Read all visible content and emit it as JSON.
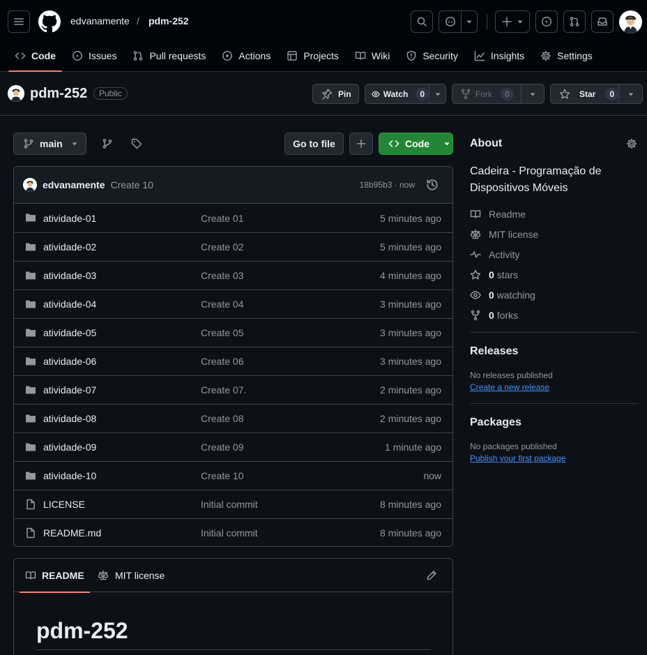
{
  "header": {
    "owner": "edvanamente",
    "separator": "/",
    "repo": "pdm-252"
  },
  "nav": [
    {
      "label": "Code",
      "icon": "code-icon"
    },
    {
      "label": "Issues",
      "icon": "issue-icon"
    },
    {
      "label": "Pull requests",
      "icon": "pull-request-icon"
    },
    {
      "label": "Actions",
      "icon": "play-icon"
    },
    {
      "label": "Projects",
      "icon": "table-icon"
    },
    {
      "label": "Wiki",
      "icon": "book-icon"
    },
    {
      "label": "Security",
      "icon": "shield-icon"
    },
    {
      "label": "Insights",
      "icon": "graph-icon"
    },
    {
      "label": "Settings",
      "icon": "gear-icon"
    }
  ],
  "repo_bar": {
    "name": "pdm-252",
    "visibility": "Public",
    "pin_label": "Pin",
    "watch_label": "Watch",
    "watch_count": "0",
    "fork_label": "Fork",
    "fork_count": "0",
    "star_label": "Star",
    "star_count": "0"
  },
  "toolbar": {
    "branch": "main",
    "go_to_file": "Go to file",
    "code_label": "Code"
  },
  "commit": {
    "author": "edvanamente",
    "message": "Create 10",
    "sha_time": "18b95b3 · now"
  },
  "files": [
    {
      "name": "atividade-01",
      "message": "Create 01",
      "time": "5 minutes ago",
      "type": "folder"
    },
    {
      "name": "atividade-02",
      "message": "Create 02",
      "time": "5 minutes ago",
      "type": "folder"
    },
    {
      "name": "atividade-03",
      "message": "Create 03",
      "time": "4 minutes ago",
      "type": "folder"
    },
    {
      "name": "atividade-04",
      "message": "Create 04",
      "time": "3 minutes ago",
      "type": "folder"
    },
    {
      "name": "atividade-05",
      "message": "Create 05",
      "time": "3 minutes ago",
      "type": "folder"
    },
    {
      "name": "atividade-06",
      "message": "Create 06",
      "time": "3 minutes ago",
      "type": "folder"
    },
    {
      "name": "atividade-07",
      "message": "Create 07.",
      "time": "2 minutes ago",
      "type": "folder"
    },
    {
      "name": "atividade-08",
      "message": "Create 08",
      "time": "2 minutes ago",
      "type": "folder"
    },
    {
      "name": "atividade-09",
      "message": "Create 09",
      "time": "1 minute ago",
      "type": "folder"
    },
    {
      "name": "atividade-10",
      "message": "Create 10",
      "time": "now",
      "type": "folder"
    },
    {
      "name": "LICENSE",
      "message": "Initial commit",
      "time": "8 minutes ago",
      "type": "file"
    },
    {
      "name": "README.md",
      "message": "Initial commit",
      "time": "8 minutes ago",
      "type": "file"
    }
  ],
  "readme": {
    "tab_readme": "README",
    "tab_license": "MIT license",
    "heading": "pdm-252"
  },
  "about": {
    "title": "About",
    "description": "Cadeira - Programação de Dispositivos Móveis",
    "readme": "Readme",
    "license": "MIT license",
    "activity": "Activity",
    "stars_count": "0",
    "stars_label": "stars",
    "watching_count": "0",
    "watching_label": "watching",
    "forks_count": "0",
    "forks_label": "forks"
  },
  "releases": {
    "title": "Releases",
    "empty": "No releases published",
    "link": "Create a new release"
  },
  "packages": {
    "title": "Packages",
    "empty": "No packages published",
    "link": "Publish your first package"
  },
  "colors": {
    "accent_green": "#238636",
    "link_blue": "#4493f8",
    "nav_underline": "#f78166"
  }
}
